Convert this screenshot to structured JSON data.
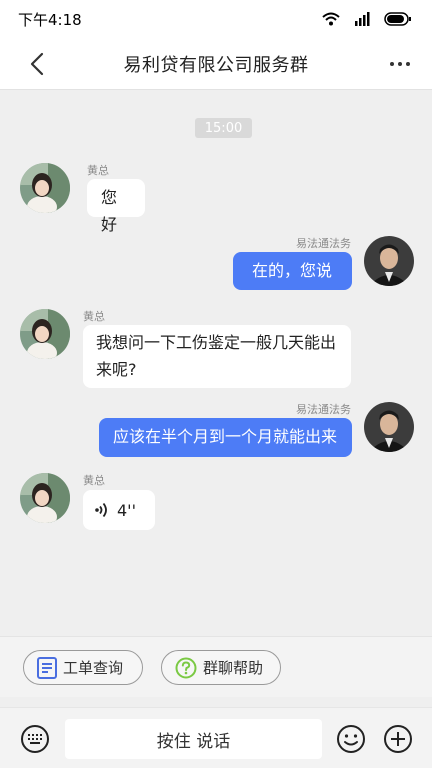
{
  "status_bar": {
    "time": "下午4:18"
  },
  "header": {
    "title": "易利贷有限公司服务群"
  },
  "chat": {
    "time_divider": "15:00",
    "messages": [
      {
        "sender": "黄总",
        "text": "您好"
      },
      {
        "sender": "易法通法务",
        "text": "在的，您说"
      },
      {
        "sender": "黄总",
        "text_line1": "我想问一下工伤鉴定一般几天能出",
        "text_line2": "来呢?"
      },
      {
        "sender": "易法通法务",
        "text": "应该在半个月到一个月就能出来"
      },
      {
        "sender": "黄总",
        "voice_duration": "4''"
      }
    ]
  },
  "quick_actions": [
    {
      "label": "工单查询",
      "icon": "document-icon",
      "color": "#4a6ee0"
    },
    {
      "label": "群聊帮助",
      "icon": "help-circle-icon",
      "color": "#7ac943"
    }
  ],
  "input_bar": {
    "hold_to_talk": "按住 说话"
  },
  "colors": {
    "accent_bubble": "#4d7cf6",
    "background": "#efefef"
  }
}
